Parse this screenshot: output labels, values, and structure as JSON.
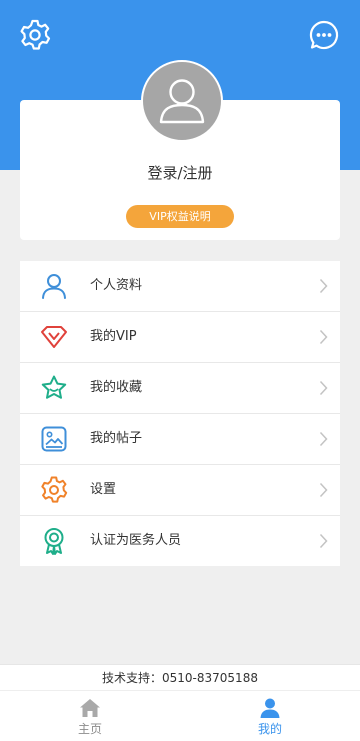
{
  "profile": {
    "login_text": "登录/注册",
    "vip_badge": "VIP权益说明"
  },
  "menu": [
    {
      "label": "个人资料",
      "icon": "user-icon"
    },
    {
      "label": "我的VIP",
      "icon": "diamond-icon"
    },
    {
      "label": "我的收藏",
      "icon": "star-icon"
    },
    {
      "label": "我的帖子",
      "icon": "picture-icon"
    },
    {
      "label": "设置",
      "icon": "gear-icon"
    },
    {
      "label": "认证为医务人员",
      "icon": "certificate-icon"
    }
  ],
  "footer": {
    "support_text": "技术支持：0510-83705188"
  },
  "tabbar": {
    "home_label": "主页",
    "mine_label": "我的"
  },
  "colors": {
    "header": "#3a93ec",
    "vip_badge": "#f4a53b",
    "active_tab": "#3a93ec"
  }
}
